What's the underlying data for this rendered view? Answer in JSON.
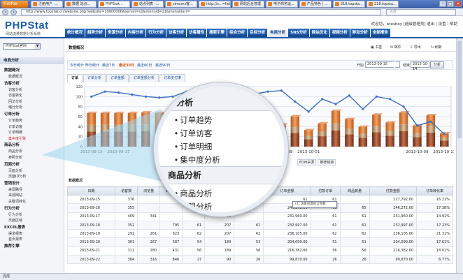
{
  "browser": {
    "menu_button": "Firefox",
    "tabs": [
      "注册用户 -...",
      "数据 站点...",
      "PHPStat...",
      "站点列表 -...",
      "simcms客...",
      "http://c...=list",
      "网站后台管理",
      "电子商务运...",
      "产品特色 | ...",
      "218.topsta...",
      "218.topsta..."
    ],
    "active_tab": 2,
    "url": "http://www.topstat.cn/website.php?website=10000006&server=s1&menuid=11&menuidarr=",
    "search_placeholder": "百度"
  },
  "header": {
    "logo": "PHPStat",
    "logo_sub": "网站流量数据分析系统",
    "user_line": "欢迎您，wiesboy [超级管理员]  退出 | 设置 | 帮助"
  },
  "main_nav": [
    "统计概况",
    "趋势分析",
    "来源分析",
    "内容分析",
    "行为分析",
    "访客分析",
    "访客属性",
    "搜索引擎",
    "综合分析",
    "目标分析",
    "电商分析",
    "SNS分析",
    "网站优化",
    "视频分析",
    "移动分析",
    "全部报告"
  ],
  "main_nav_active": 10,
  "sidebar": {
    "site_select": "PHPStat官网",
    "head": "电商分析",
    "groups": [
      {
        "label": "数据概况",
        "items": [
          "数据概况"
        ]
      },
      {
        "label": "访客分析",
        "items": [
          "访客分析",
          "访客转化",
          "回访分析",
          "缩分分析"
        ]
      },
      {
        "label": "订单分析",
        "items": [
          "订单趋势",
          "订单访客",
          "订单明细",
          "集中度引擎"
        ]
      },
      {
        "label": "商品分析",
        "items": [
          "商品分析",
          "参照分析"
        ]
      },
      {
        "label": "页面分析",
        "items": [
          "页面分析",
          "页面ID分析"
        ]
      },
      {
        "label": "营销设计",
        "items": [
          "来源路径",
          "来源网站",
          "关键词转化"
        ]
      },
      {
        "label": "行为分析",
        "items": [
          "行为分析",
          "页面区域"
        ]
      },
      {
        "label": "EXCEL报表",
        "items": [
          "渠道报表",
          "首页报表"
        ]
      },
      {
        "label": "推荐引擎",
        "items": []
      }
    ]
  },
  "content": {
    "title": "数据概况",
    "tools": [
      "书签",
      "邮件",
      "导出",
      "刷新"
    ],
    "date_links": [
      "今日统计",
      "昨日统计",
      "最近7日",
      "最近30日",
      "最近60日",
      "最近90日"
    ],
    "date_selected": 3,
    "start_label": "开始",
    "start_value": "2013-09-15",
    "end_label": "结束",
    "end_value": "2013-10-14",
    "go_label": "分析",
    "sub_tabs": [
      "订单",
      "订单分析",
      "订单金额",
      "订单金额分析",
      "订单支付率"
    ],
    "sub_tab_active": 0,
    "legend": [
      "EDM来源",
      "推荐链接"
    ],
    "table_title": "数据概况",
    "tooltip": "(1) 访客创建的订单数"
  },
  "chart_data": {
    "type": "bar",
    "categories": [
      "2013-09-15",
      "2013-09-16",
      "2013-09-17",
      "2013-09-18",
      "2013-09-19",
      "2013-09-20",
      "2013-09-21",
      "2013-09-22",
      "2013-09-23",
      "2013-09-24",
      "2013-09-25",
      "2013-09-26",
      "2013-09-27",
      "2013-09-28",
      "2013-09-29",
      "2013-09-30",
      "2013-10-01",
      "2013-10-02",
      "2013-10-03",
      "2013-10-04",
      "2013-10-05",
      "2013-10-06",
      "2013-10-07",
      "2013-10-08",
      "2013-10-09",
      "2013-10-10",
      "2013-10-11"
    ],
    "x_tick_labels": [
      "2013-09-15",
      "2013-09-17",
      "2013-09-29",
      "2013-10-01",
      "2013-10-09",
      "2013-10-11"
    ],
    "values": [
      61,
      61,
      61,
      61,
      62,
      61,
      62,
      26,
      58,
      45,
      36,
      60,
      54,
      48,
      40,
      55,
      30,
      42,
      65,
      50,
      36,
      58,
      44,
      62,
      38,
      57,
      24
    ],
    "line_values": [
      100,
      110,
      108,
      104,
      100,
      98,
      100,
      110,
      106,
      95,
      100,
      108,
      105,
      110,
      112,
      90,
      70,
      95,
      85,
      102,
      75,
      100,
      95,
      80,
      42,
      50,
      25
    ],
    "y_ticks": [
      0,
      20,
      40,
      60,
      80,
      100,
      120
    ],
    "ylim": [
      0,
      120
    ],
    "grid": true
  },
  "table": {
    "headers": [
      "日期",
      "访客数",
      "浏览量",
      "转化率",
      "订单数",
      "订单金额",
      "商品数量",
      "订单金额",
      "付款订单",
      "商品数量",
      "付款金额",
      "订单转化率"
    ],
    "rows": [
      [
        "2013-09-15",
        "376",
        "",
        "",
        "",
        "61",
        "",
        "61",
        "61",
        "",
        "227,792.00",
        "16.22%"
      ],
      [
        "2013-09-16",
        "355",
        "",
        "",
        "",
        "61",
        "",
        "246,272.00",
        "61",
        "65",
        "246,272.00",
        "17.38%"
      ],
      [
        "2013-09-17",
        "409",
        "341",
        "",
        "",
        "61",
        "",
        "231,960.00",
        "61",
        "61",
        "231,960.00",
        "14.91%"
      ],
      [
        "2013-09-18",
        "352",
        "",
        "795",
        "61",
        "207",
        "61",
        "232,997.00",
        "61",
        "61",
        "232,997.00",
        "17.23%"
      ],
      [
        "2013-09-19",
        "291",
        "261",
        "623",
        "62",
        "207",
        "62",
        "236,105.00",
        "62",
        "62",
        "236,105.00",
        "21.31%"
      ],
      [
        "2013-09-20",
        "301",
        "267",
        "587",
        "54",
        "180",
        "53",
        "204,099.00",
        "51",
        "51",
        "204,099.00",
        "17.61%"
      ],
      [
        "2013-09-21",
        "311",
        "280",
        "431",
        "56",
        "189",
        "56",
        "216,382.00",
        "56",
        "56",
        "216,382.00",
        "18.01%"
      ],
      [
        "2013-09-22",
        "384",
        "316",
        "846",
        "27",
        "90",
        "26",
        "99,870.00",
        "26",
        "26",
        "99,870.00",
        "6.77%"
      ]
    ]
  },
  "magnifier": {
    "head1": "单分析",
    "items1": [
      "订单趋势",
      "订单访客",
      "订单明细",
      "集中度分析"
    ],
    "head2": "商品分析",
    "items2": [
      "商品分析",
      "象限分析"
    ]
  },
  "status": "完成"
}
